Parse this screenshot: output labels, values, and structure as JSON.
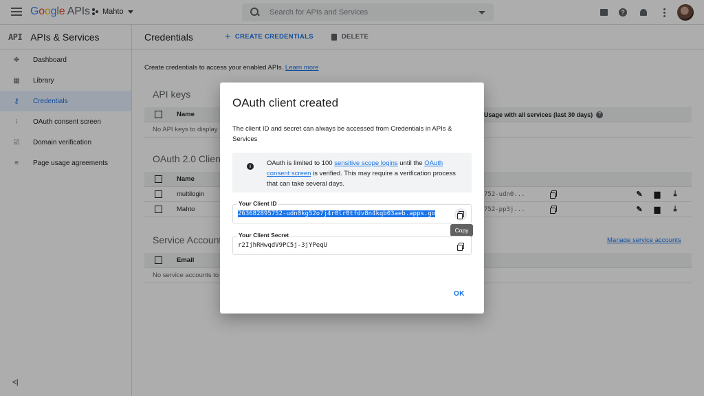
{
  "topbar": {
    "logo_google": "Google",
    "logo_apis": "APIs",
    "project_name": "Mahto",
    "search_placeholder": "Search for APIs and Services"
  },
  "sidebar": {
    "api_badge": "API",
    "title": "APIs & Services",
    "items": [
      {
        "label": "Dashboard",
        "icon": "dashboard-icon",
        "active": false
      },
      {
        "label": "Library",
        "icon": "library-icon",
        "active": false
      },
      {
        "label": "Credentials",
        "icon": "key-icon",
        "active": true
      },
      {
        "label": "OAuth consent screen",
        "icon": "consent-icon",
        "active": false
      },
      {
        "label": "Domain verification",
        "icon": "checkbox-icon",
        "active": false
      },
      {
        "label": "Page usage agreements",
        "icon": "settings-list-icon",
        "active": false
      }
    ],
    "collapse_label": "<|"
  },
  "header": {
    "title": "Credentials",
    "create_label": "CREATE CREDENTIALS",
    "delete_label": "DELETE"
  },
  "main": {
    "intro_text": "Create credentials to access your enabled APIs.",
    "learn_more": "Learn more",
    "api_keys": {
      "title": "API keys",
      "col_name": "Name",
      "col_usage": "Usage with all services (last 30 days)",
      "empty": "No API keys to display"
    },
    "oauth": {
      "title": "OAuth 2.0 Client IDs",
      "col_name": "Name",
      "rows": [
        {
          "name": "multilogin",
          "client_id": "752-udn0..."
        },
        {
          "name": "Mahto",
          "client_id": "752-pp3j..."
        }
      ]
    },
    "service": {
      "title": "Service Accounts",
      "col_email": "Email",
      "empty": "No service accounts to display",
      "manage_link": "Manage service accounts"
    }
  },
  "dialog": {
    "title": "OAuth client created",
    "description": "The client ID and secret can always be accessed from Credentials in APIs & Services",
    "info": {
      "text_1": "OAuth is limited to 100 ",
      "link_1": "sensitive scope logins",
      "text_2": " until the ",
      "link_2": "OAuth consent screen",
      "text_3": " is verified. This may require a verification process that can take several days."
    },
    "client_id_label": "Your Client ID",
    "client_id_value": "263682895752-udn0kg52o7j4r0lr0tfdv8n4kqb03aeb.apps.go",
    "client_secret_label": "Your Client Secret",
    "client_secret_value": "r2IjhRHwqdV9PC5j-3jYPeqU",
    "tooltip": "Copy",
    "ok_label": "OK"
  },
  "colors": {
    "accent": "#1a73e8",
    "active_bg": "#e8f0fe",
    "overlay": "rgba(0,0,0,0.32)"
  }
}
